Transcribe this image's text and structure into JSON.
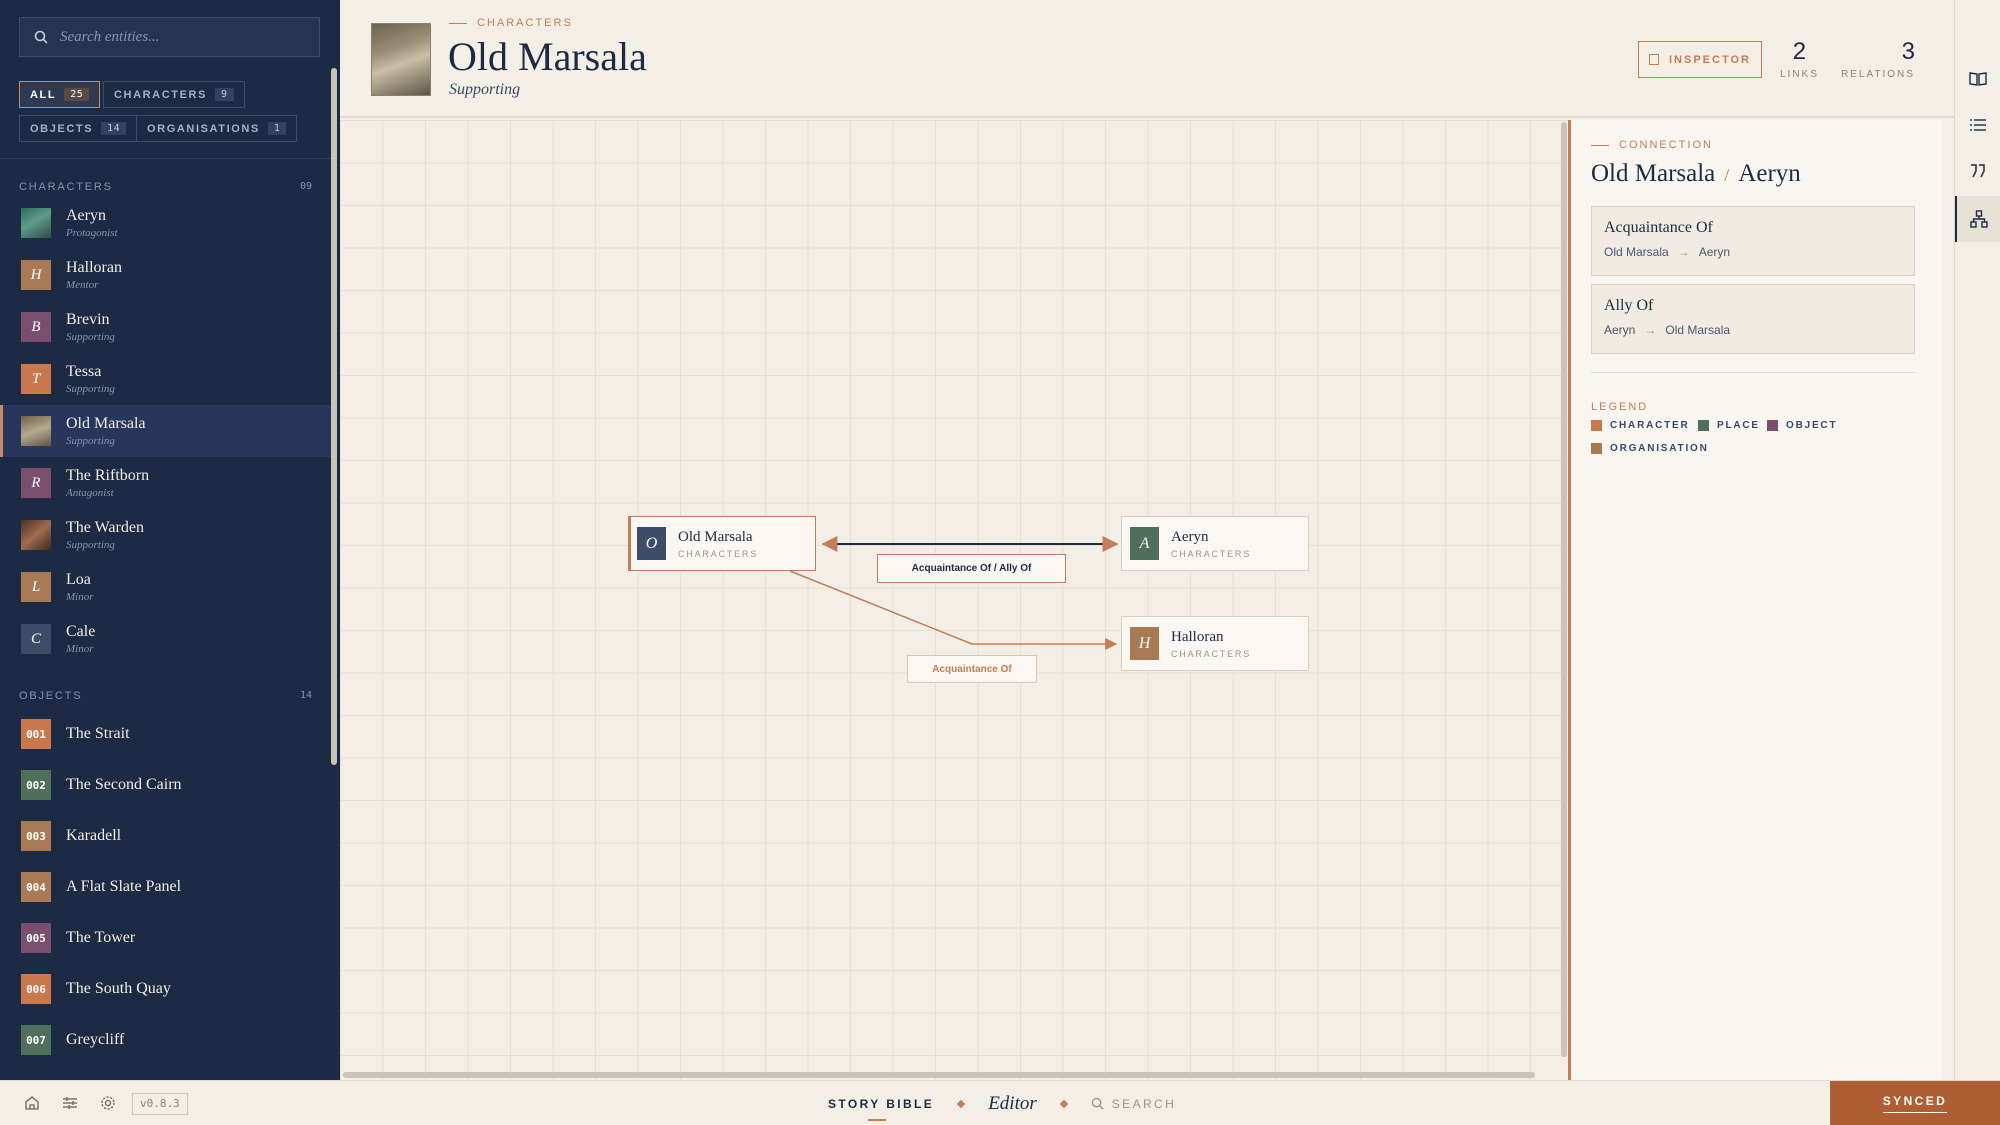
{
  "sidebar": {
    "search_placeholder": "Search entities...",
    "filters": [
      {
        "label": "ALL",
        "count": "25"
      },
      {
        "label": "CHARACTERS",
        "count": "9"
      },
      {
        "label": "OBJECTS",
        "count": "14"
      },
      {
        "label": "ORGANISATIONS",
        "count": "1"
      }
    ],
    "characters_header": "CHARACTERS",
    "characters_count": "09",
    "characters": [
      {
        "name": "Aeryn",
        "role": "Protagonist",
        "initial": "",
        "color": "#3f7a6a"
      },
      {
        "name": "Halloran",
        "role": "Mentor",
        "initial": "H",
        "color": "#a87a53"
      },
      {
        "name": "Brevin",
        "role": "Supporting",
        "initial": "B",
        "color": "#7a4f6e"
      },
      {
        "name": "Tessa",
        "role": "Supporting",
        "initial": "T",
        "color": "#c9784e"
      },
      {
        "name": "Old Marsala",
        "role": "Supporting",
        "initial": "",
        "color": "#8a7f6c"
      },
      {
        "name": "The Riftborn",
        "role": "Antagonist",
        "initial": "R",
        "color": "#7a4f6e"
      },
      {
        "name": "The Warden",
        "role": "Supporting",
        "initial": "",
        "color": "#6b4e3c"
      },
      {
        "name": "Loa",
        "role": "Minor",
        "initial": "L",
        "color": "#a87a53"
      },
      {
        "name": "Cale",
        "role": "Minor",
        "initial": "C",
        "color": "#3d4c68"
      }
    ],
    "objects_header": "OBJECTS",
    "objects_count": "14",
    "objects": [
      {
        "code": "001",
        "name": "The Strait",
        "color": "#c9784e"
      },
      {
        "code": "002",
        "name": "The Second Cairn",
        "color": "#4f6e5c"
      },
      {
        "code": "003",
        "name": "Karadell",
        "color": "#a87a53"
      },
      {
        "code": "004",
        "name": "A Flat Slate Panel",
        "color": "#a87a53"
      },
      {
        "code": "005",
        "name": "The Tower",
        "color": "#7a4f6e"
      },
      {
        "code": "006",
        "name": "The South Quay",
        "color": "#c9784e"
      },
      {
        "code": "007",
        "name": "Greycliff",
        "color": "#4f6e5c"
      }
    ]
  },
  "header": {
    "breadcrumb": "CHARACTERS",
    "title": "Old Marsala",
    "subtitle": "Supporting",
    "inspector_label": "INSPECTOR",
    "links_value": "2",
    "links_label": "LINKS",
    "relations_value": "3",
    "relations_label": "RELATIONS"
  },
  "graph": {
    "nodes": [
      {
        "name": "Old Marsala",
        "type": "CHARACTERS",
        "initial": "O",
        "color": "#3d4c68"
      },
      {
        "name": "Aeryn",
        "type": "CHARACTERS",
        "initial": "A",
        "color": "#4f6e5c"
      },
      {
        "name": "Halloran",
        "type": "CHARACTERS",
        "initial": "H",
        "color": "#a87a53"
      }
    ],
    "edge_labels": [
      "Acquaintance Of / Ally Of",
      "Acquaintance Of"
    ]
  },
  "inspector": {
    "breadcrumb": "CONNECTION",
    "from": "Old Marsala",
    "separator": "/",
    "to": "Aeryn",
    "relations": [
      {
        "name": "Acquaintance Of",
        "from": "Old Marsala",
        "to": "Aeryn"
      },
      {
        "name": "Ally Of",
        "from": "Aeryn",
        "to": "Old Marsala"
      }
    ],
    "legend_header": "LEGEND",
    "legend": [
      {
        "label": "CHARACTER",
        "color": "#c9784e"
      },
      {
        "label": "PLACE",
        "color": "#4f6e5c"
      },
      {
        "label": "OBJECT",
        "color": "#7a4f6e"
      },
      {
        "label": "ORGANISATION",
        "color": "#a87a53"
      }
    ]
  },
  "footer": {
    "version": "v0.8.3",
    "story_bible": "STORY BIBLE",
    "editor": "Editor",
    "search": "SEARCH",
    "synced": "SYNCED"
  },
  "colors": {
    "navy": "#1c2a44",
    "accent": "#c47d55",
    "paper": "#f3eee6",
    "synced": "#b05f35"
  }
}
